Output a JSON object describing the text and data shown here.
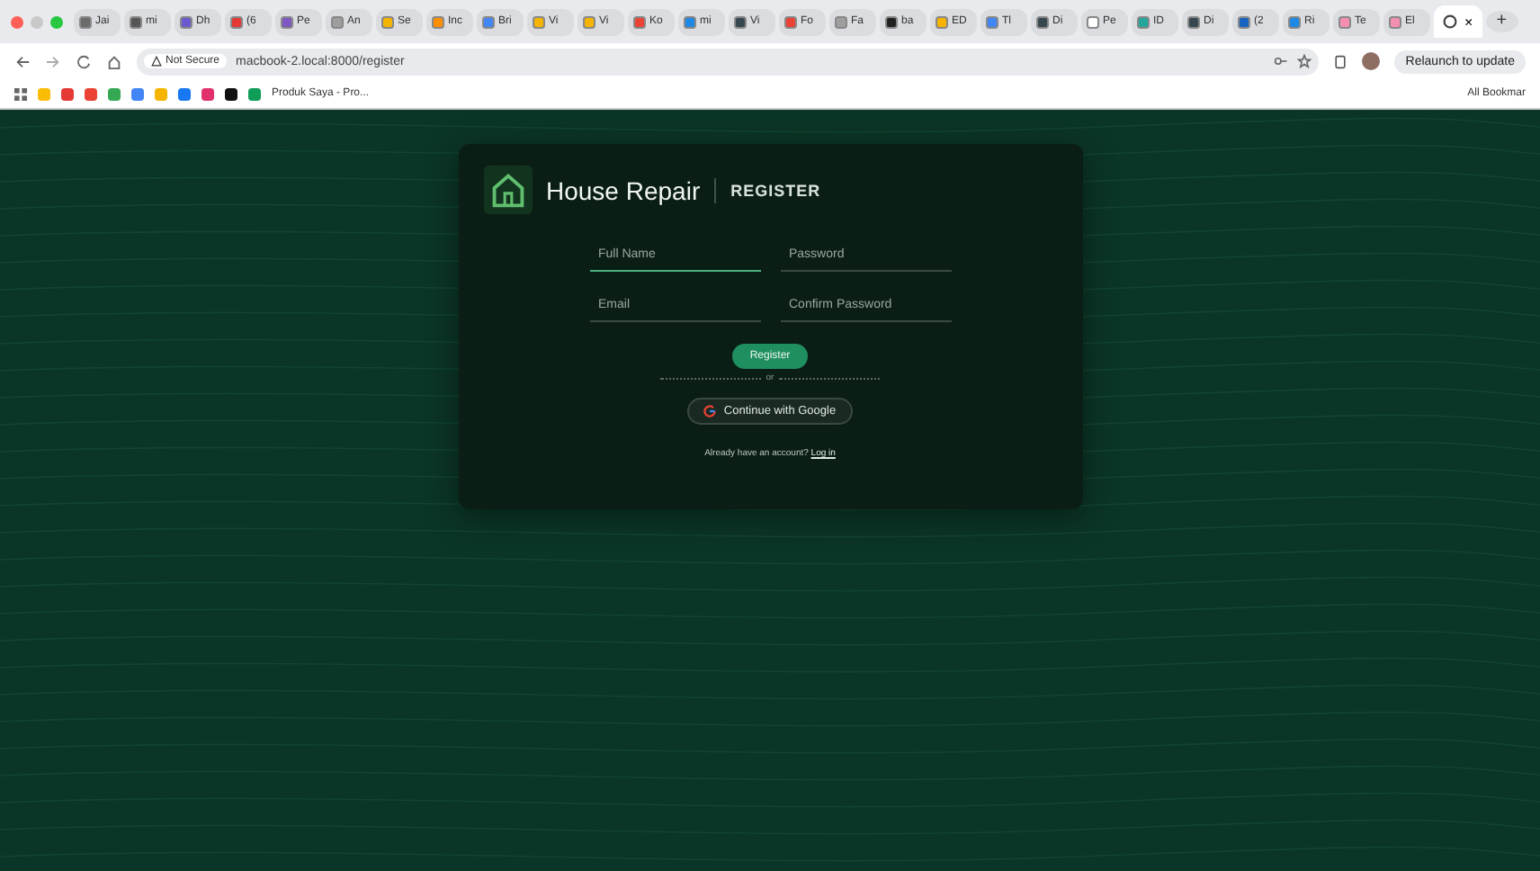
{
  "browser": {
    "tabs": [
      {
        "title": "Jai",
        "color": "#6b6b6b",
        "selected": false
      },
      {
        "title": "mi",
        "color": "#555555",
        "selected": false
      },
      {
        "title": "Dh",
        "color": "#6a5acd",
        "selected": false
      },
      {
        "title": "(6",
        "color": "#e53935",
        "selected": false
      },
      {
        "title": "Pe",
        "color": "#7e57c2",
        "selected": false
      },
      {
        "title": "An",
        "color": "#9e9e9e",
        "selected": false
      },
      {
        "title": "Se",
        "color": "#f4b400",
        "selected": false
      },
      {
        "title": "Inc",
        "color": "#ff8f00",
        "selected": false
      },
      {
        "title": "Bri",
        "color": "#4285f4",
        "selected": false
      },
      {
        "title": "Vi",
        "color": "#f4b400",
        "selected": false
      },
      {
        "title": "Vi",
        "color": "#f4b400",
        "selected": false
      },
      {
        "title": "Ko",
        "color": "#ea4335",
        "selected": false
      },
      {
        "title": "mi",
        "color": "#1e88e5",
        "selected": false
      },
      {
        "title": "Vi",
        "color": "#37474f",
        "selected": false
      },
      {
        "title": "Fo",
        "color": "#ea4335",
        "selected": false
      },
      {
        "title": "Fa",
        "color": "#9e9e9e",
        "selected": false
      },
      {
        "title": "ba",
        "color": "#212121",
        "selected": false
      },
      {
        "title": "ED",
        "color": "#f4b400",
        "selected": false
      },
      {
        "title": "Tl",
        "color": "#4285f4",
        "selected": false
      },
      {
        "title": "Di",
        "color": "#37474f",
        "selected": false
      },
      {
        "title": "Pe",
        "color": "#ffffff",
        "selected": false
      },
      {
        "title": "ID",
        "color": "#26a69a",
        "selected": false
      },
      {
        "title": "Di",
        "color": "#37474f",
        "selected": false
      },
      {
        "title": "(2",
        "color": "#1565c0",
        "selected": false
      },
      {
        "title": "Ri",
        "color": "#1e88e5",
        "selected": false
      },
      {
        "title": "Te",
        "color": "#f48fb1",
        "selected": false
      },
      {
        "title": "El",
        "color": "#f48fb1",
        "selected": false
      }
    ],
    "active_tab": {
      "close": "×"
    },
    "new_tab": "+",
    "security": "Not Secure",
    "url": "macbook-2.local:8000/register",
    "relaunch": "Relaunch to update",
    "bookmark_icons": [
      {
        "color": "#fbbc05"
      },
      {
        "color": "#e53935"
      },
      {
        "color": "#ea4335"
      },
      {
        "color": "#34a853"
      },
      {
        "color": "#4285f4"
      },
      {
        "color": "#f4b400"
      },
      {
        "color": "#1877f2"
      },
      {
        "color": "#e1306c"
      },
      {
        "color": "#111111"
      },
      {
        "color": "#0f9d58"
      }
    ],
    "bookmark": "Produk Saya - Pro...",
    "all_bookmarks": "All Bookmar"
  },
  "card": {
    "brand": "House Repair",
    "section": "REGISTER",
    "fields": [
      {
        "placeholder": "Full Name",
        "focused": true
      },
      {
        "placeholder": "Password",
        "focused": false
      },
      {
        "placeholder": "Email",
        "focused": false
      },
      {
        "placeholder": "Confirm Password",
        "focused": false
      }
    ],
    "submit": "Register",
    "divider": "or",
    "google": "Continue with Google",
    "prompt": "Already have an account?",
    "login": "Log in"
  }
}
